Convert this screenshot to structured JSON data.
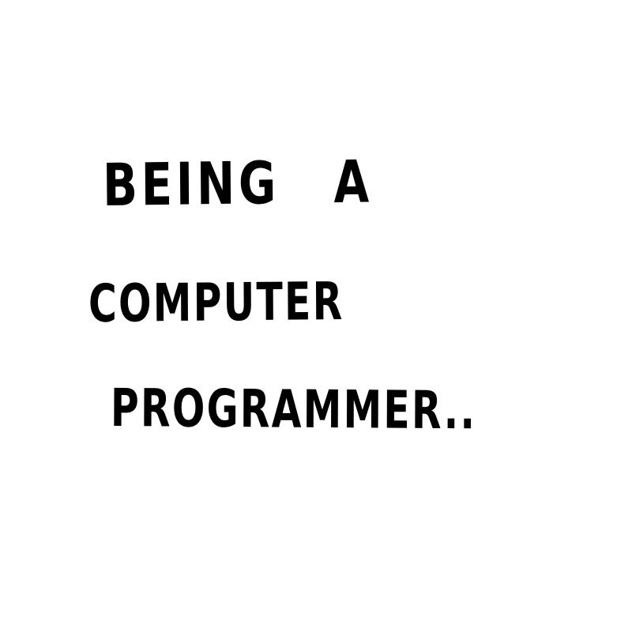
{
  "text": {
    "line1": "Being a",
    "line2": "Computer",
    "line3": "programmer.."
  },
  "colors": {
    "background": "#ffffff",
    "ink": "#000000"
  }
}
